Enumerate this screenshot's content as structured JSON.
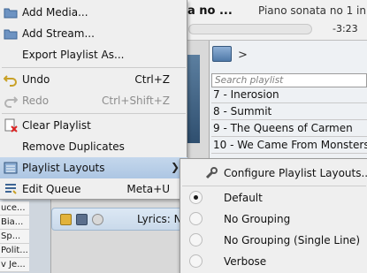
{
  "now_playing": {
    "title": "ata no ...",
    "subtitle": "Piano sonata no 1 in",
    "time_remaining": "-3:23"
  },
  "playlist": {
    "search_placeholder": "Search playlist",
    "rows": [
      "7 - Inerosion",
      "8 - Summit",
      "9 - The Queens of Carmen",
      "10 - We Came From Monsters"
    ]
  },
  "left_column": {
    "items": [
      "uce...",
      "Bia...",
      "Sp...",
      "Polit...",
      "v Je..."
    ]
  },
  "lyrics_bar": {
    "label": "Lyrics: N"
  },
  "menu": {
    "items": [
      {
        "label": "Add Media...",
        "shortcut": "",
        "icon": "add-media-icon",
        "disabled": false
      },
      {
        "label": "Add Stream...",
        "shortcut": "",
        "icon": "add-stream-icon",
        "disabled": false
      },
      {
        "label": "Export Playlist As...",
        "shortcut": "",
        "icon": "",
        "disabled": false
      },
      {
        "label": "Undo",
        "shortcut": "Ctrl+Z",
        "icon": "undo-icon",
        "disabled": false
      },
      {
        "label": "Redo",
        "shortcut": "Ctrl+Shift+Z",
        "icon": "redo-icon",
        "disabled": true
      },
      {
        "label": "Clear Playlist",
        "shortcut": "",
        "icon": "clear-playlist-icon",
        "disabled": false
      },
      {
        "label": "Remove Duplicates",
        "shortcut": "",
        "icon": "",
        "disabled": false
      },
      {
        "label": "Playlist Layouts",
        "shortcut": "",
        "icon": "playlist-layouts-icon",
        "disabled": false,
        "has_submenu": true,
        "highlighted": true
      },
      {
        "label": "Edit Queue",
        "shortcut": "Meta+U",
        "icon": "edit-queue-icon",
        "disabled": false
      }
    ]
  },
  "submenu": {
    "configure_label": "Configure Playlist Layouts...",
    "layouts": [
      {
        "label": "Default",
        "checked": true
      },
      {
        "label": "No Grouping",
        "checked": false
      },
      {
        "label": "No Grouping (Single Line)",
        "checked": false
      },
      {
        "label": "Verbose",
        "checked": false
      }
    ]
  },
  "colors": {
    "highlight": "#b7cde7",
    "menu_bg": "#efefef",
    "disabled_text": "#8d8d8d"
  }
}
